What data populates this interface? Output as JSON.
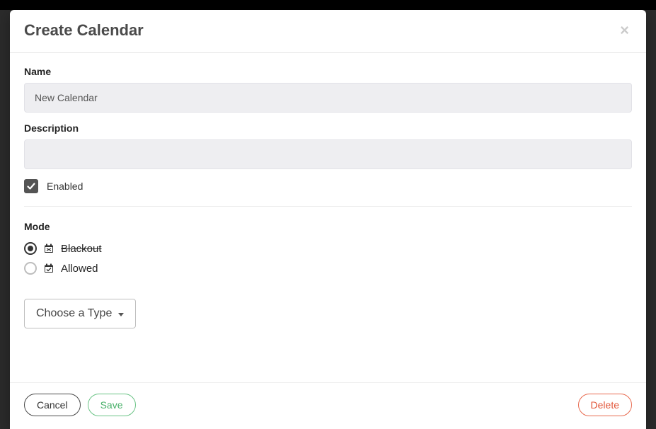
{
  "modal": {
    "title": "Create Calendar"
  },
  "form": {
    "name_label": "Name",
    "name_value": "New Calendar",
    "description_label": "Description",
    "description_value": "",
    "enabled_label": "Enabled",
    "enabled_checked": true,
    "mode_label": "Mode",
    "mode_options": {
      "blackout": "Blackout",
      "allowed": "Allowed"
    },
    "mode_selected": "blackout",
    "type_dropdown_label": "Choose a Type"
  },
  "footer": {
    "cancel_label": "Cancel",
    "save_label": "Save",
    "delete_label": "Delete"
  }
}
